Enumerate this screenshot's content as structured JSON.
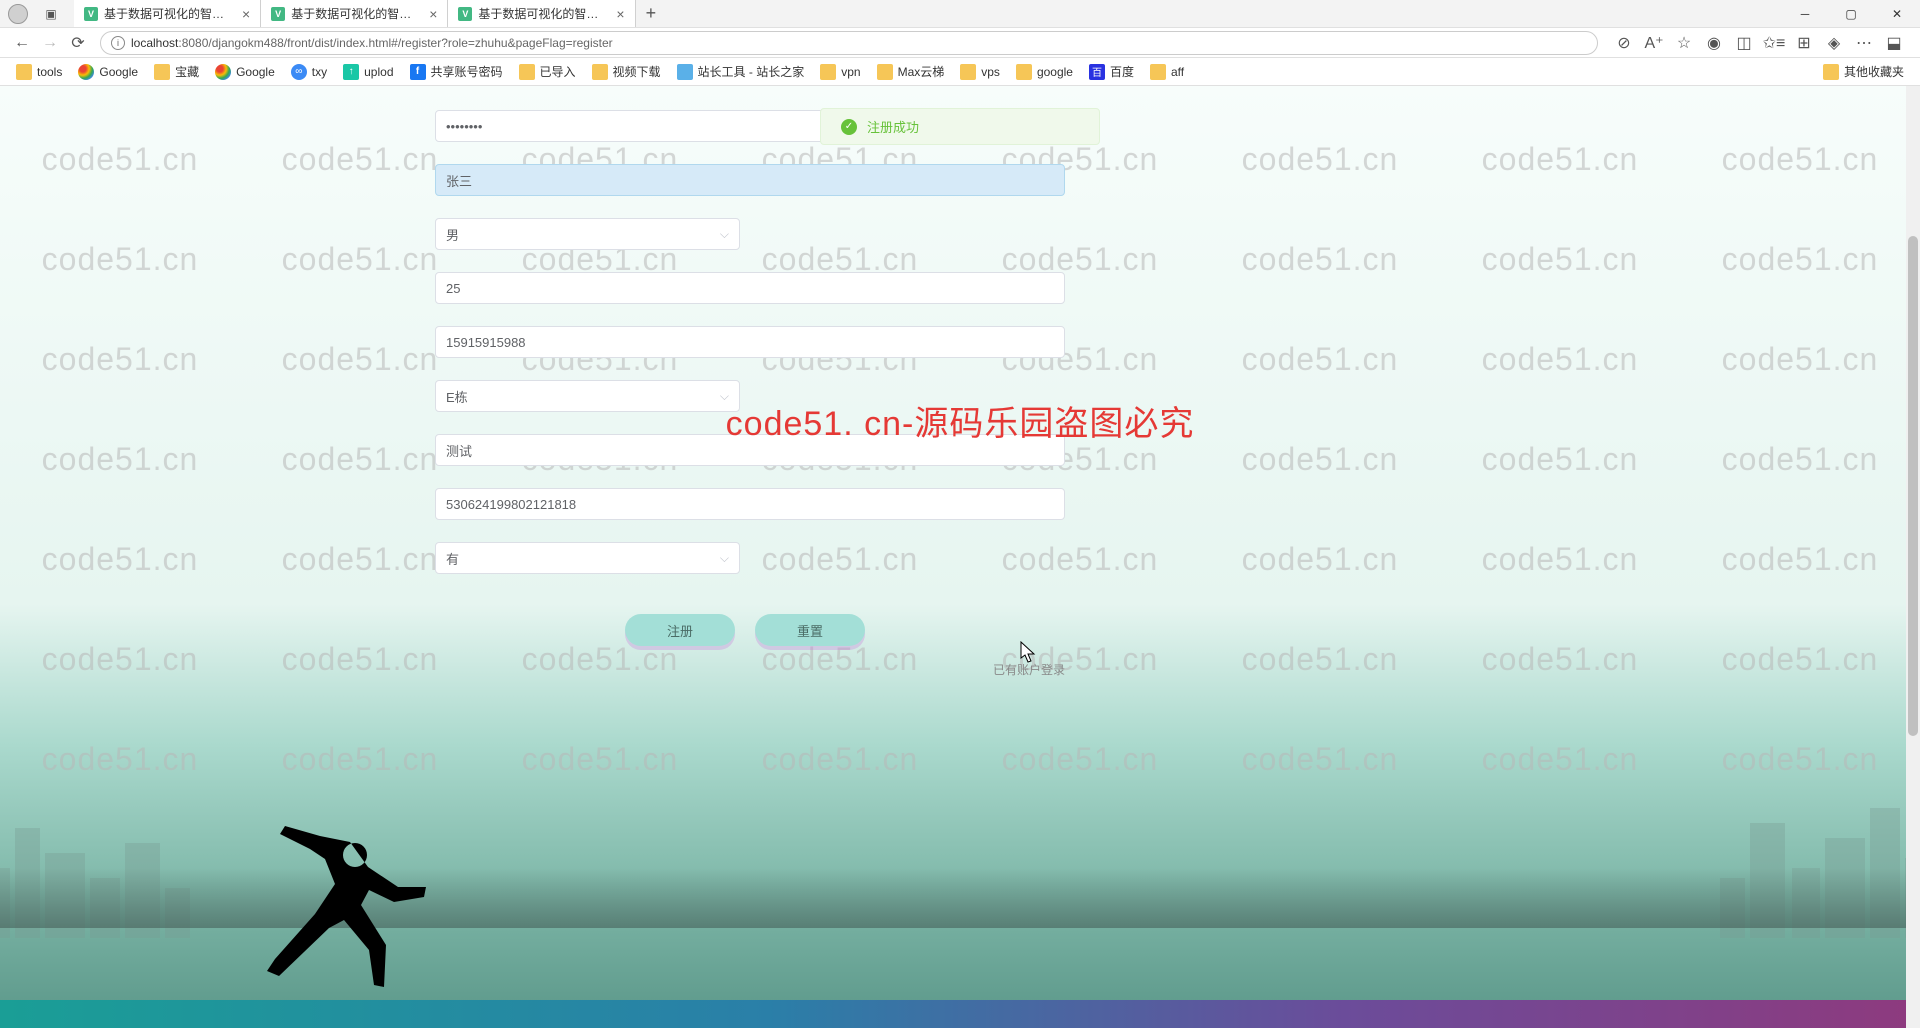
{
  "browser": {
    "tabs": [
      {
        "title": "基于数据可视化的智慧社区内网"
      },
      {
        "title": "基于数据可视化的智慧社区内网"
      },
      {
        "title": "基于数据可视化的智慧社区内网"
      }
    ],
    "url_host": "localhost",
    "url_port_path": ":8080/djangokm488/front/dist/index.html#/register?role=zhuhu&pageFlag=register",
    "bookmarks": [
      {
        "label": "tools",
        "type": "folder"
      },
      {
        "label": "Google",
        "type": "google"
      },
      {
        "label": "宝藏",
        "type": "folder"
      },
      {
        "label": "Google",
        "type": "google"
      },
      {
        "label": "txy",
        "type": "tx"
      },
      {
        "label": "uplod",
        "type": "upload"
      },
      {
        "label": "共享账号密码",
        "type": "fb"
      },
      {
        "label": "已导入",
        "type": "folder"
      },
      {
        "label": "视频下载",
        "type": "folder"
      },
      {
        "label": "站长工具 - 站长之家",
        "type": "plain"
      },
      {
        "label": "vpn",
        "type": "folder"
      },
      {
        "label": "Max云梯",
        "type": "folder"
      },
      {
        "label": "vps",
        "type": "folder"
      },
      {
        "label": "google",
        "type": "folder"
      },
      {
        "label": "百度",
        "type": "baidu"
      },
      {
        "label": "aff",
        "type": "folder"
      }
    ],
    "overflow_label": "其他收藏夹"
  },
  "toast": {
    "message": "注册成功"
  },
  "form": {
    "password": "••••••••",
    "name": "张三",
    "gender": "男",
    "age": "25",
    "phone": "15915915988",
    "building": "E栋",
    "note": "测试",
    "idcard": "530624199802121818",
    "has_account": "有",
    "submit_label": "注册",
    "reset_label": "重置",
    "login_link": "已有账户登录"
  },
  "watermark": {
    "text": "code51.cn",
    "warning": "code51. cn-源码乐园盗图必究"
  }
}
